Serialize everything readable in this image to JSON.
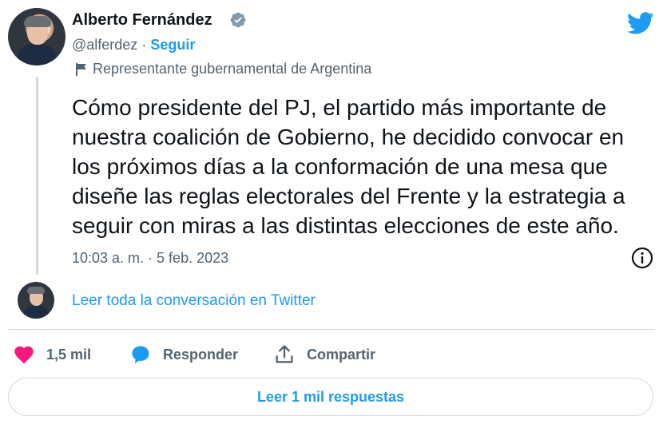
{
  "author": {
    "name": "Alberto Fernández",
    "handle": "@alferdez",
    "separator": "·",
    "follow_label": "Seguir",
    "government_label": "Representante gubernamental de Argentina"
  },
  "tweet": {
    "text": "Cómo presidente del PJ, el partido más importante de nuestra coalición de Gobierno, he decidido convocar en los próximos días a la conformación de una mesa que diseñe las reglas electorales del Frente y la estrategia a seguir con miras a las distintas elecciones de este año.",
    "timestamp": "10:03 a. m. · 5 feb. 2023"
  },
  "conversation": {
    "link_label": "Leer toda la conversación en Twitter"
  },
  "actions": {
    "like_count": "1,5 mil",
    "reply_label": "Responder",
    "share_label": "Compartir"
  },
  "footer": {
    "replies_button": "Leer 1 mil respuestas"
  },
  "colors": {
    "accent": "#1d9bf0",
    "heart": "#f91880",
    "muted": "#536471",
    "text": "#0f1419",
    "border": "#cfd9de"
  },
  "icons": [
    "verified-badge-icon",
    "twitter-bird-icon",
    "flag-icon",
    "info-icon",
    "heart-icon",
    "reply-bubble-icon",
    "share-icon"
  ]
}
